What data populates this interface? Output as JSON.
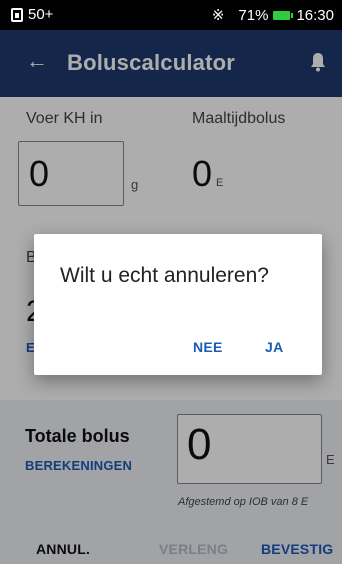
{
  "status_bar": {
    "notification_count": "50+",
    "battery_percent": "71%",
    "time": "16:30"
  },
  "app_bar": {
    "title": "Boluscalculator"
  },
  "carbs": {
    "label": "Voer KH in",
    "value": "0",
    "unit": "g"
  },
  "meal_bolus": {
    "label": "Maaltijdbolus",
    "value": "0",
    "unit": "E"
  },
  "glucose_partial": {
    "label_initial": "B",
    "value_initial": "2",
    "link_initial": "E"
  },
  "total_bolus": {
    "label": "Totale bolus",
    "calculations_link": "BEREKENINGEN",
    "value": "0",
    "unit": "E",
    "iob_note": "Afgestemd op IOB van 8 E"
  },
  "actions": {
    "cancel": "ANNUL.",
    "extend": "VERLENG",
    "confirm": "BEVESTIG"
  },
  "dialog": {
    "question": "Wilt u echt annuleren?",
    "no_label": "NEE",
    "yes_label": "JA"
  },
  "colors": {
    "app_bar": "#1e3a6e",
    "accent": "#1e5bb8",
    "battery": "#2ecc40"
  }
}
